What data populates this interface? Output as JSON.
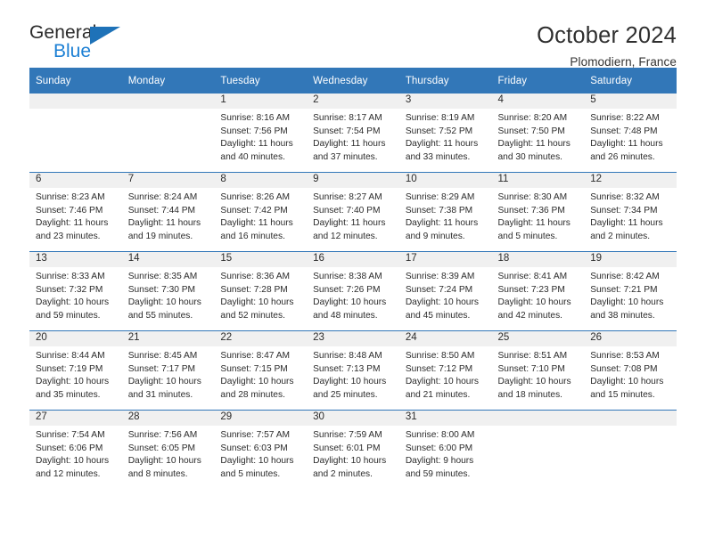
{
  "logo": {
    "text_top": "General",
    "text_bottom": "Blue",
    "triangle_color": "#1e72b8",
    "blue_color": "#1b7fd4"
  },
  "header": {
    "title": "October 2024",
    "subtitle": "Plomodiern, France"
  },
  "theme": {
    "header_blue": "#3277b8",
    "daynum_band": "#f0f0f0",
    "text": "#2b2b2b"
  },
  "weekdays": [
    "Sunday",
    "Monday",
    "Tuesday",
    "Wednesday",
    "Thursday",
    "Friday",
    "Saturday"
  ],
  "labels": {
    "sunrise_prefix": "Sunrise:",
    "sunset_prefix": "Sunset:",
    "daylight_prefix": "Daylight:"
  },
  "weeks": [
    [
      {
        "day": "",
        "sunrise": "",
        "sunset": "",
        "daylight": ""
      },
      {
        "day": "",
        "sunrise": "",
        "sunset": "",
        "daylight": ""
      },
      {
        "day": "1",
        "sunrise": "Sunrise: 8:16 AM",
        "sunset": "Sunset: 7:56 PM",
        "daylight": "Daylight: 11 hours and 40 minutes."
      },
      {
        "day": "2",
        "sunrise": "Sunrise: 8:17 AM",
        "sunset": "Sunset: 7:54 PM",
        "daylight": "Daylight: 11 hours and 37 minutes."
      },
      {
        "day": "3",
        "sunrise": "Sunrise: 8:19 AM",
        "sunset": "Sunset: 7:52 PM",
        "daylight": "Daylight: 11 hours and 33 minutes."
      },
      {
        "day": "4",
        "sunrise": "Sunrise: 8:20 AM",
        "sunset": "Sunset: 7:50 PM",
        "daylight": "Daylight: 11 hours and 30 minutes."
      },
      {
        "day": "5",
        "sunrise": "Sunrise: 8:22 AM",
        "sunset": "Sunset: 7:48 PM",
        "daylight": "Daylight: 11 hours and 26 minutes."
      }
    ],
    [
      {
        "day": "6",
        "sunrise": "Sunrise: 8:23 AM",
        "sunset": "Sunset: 7:46 PM",
        "daylight": "Daylight: 11 hours and 23 minutes."
      },
      {
        "day": "7",
        "sunrise": "Sunrise: 8:24 AM",
        "sunset": "Sunset: 7:44 PM",
        "daylight": "Daylight: 11 hours and 19 minutes."
      },
      {
        "day": "8",
        "sunrise": "Sunrise: 8:26 AM",
        "sunset": "Sunset: 7:42 PM",
        "daylight": "Daylight: 11 hours and 16 minutes."
      },
      {
        "day": "9",
        "sunrise": "Sunrise: 8:27 AM",
        "sunset": "Sunset: 7:40 PM",
        "daylight": "Daylight: 11 hours and 12 minutes."
      },
      {
        "day": "10",
        "sunrise": "Sunrise: 8:29 AM",
        "sunset": "Sunset: 7:38 PM",
        "daylight": "Daylight: 11 hours and 9 minutes."
      },
      {
        "day": "11",
        "sunrise": "Sunrise: 8:30 AM",
        "sunset": "Sunset: 7:36 PM",
        "daylight": "Daylight: 11 hours and 5 minutes."
      },
      {
        "day": "12",
        "sunrise": "Sunrise: 8:32 AM",
        "sunset": "Sunset: 7:34 PM",
        "daylight": "Daylight: 11 hours and 2 minutes."
      }
    ],
    [
      {
        "day": "13",
        "sunrise": "Sunrise: 8:33 AM",
        "sunset": "Sunset: 7:32 PM",
        "daylight": "Daylight: 10 hours and 59 minutes."
      },
      {
        "day": "14",
        "sunrise": "Sunrise: 8:35 AM",
        "sunset": "Sunset: 7:30 PM",
        "daylight": "Daylight: 10 hours and 55 minutes."
      },
      {
        "day": "15",
        "sunrise": "Sunrise: 8:36 AM",
        "sunset": "Sunset: 7:28 PM",
        "daylight": "Daylight: 10 hours and 52 minutes."
      },
      {
        "day": "16",
        "sunrise": "Sunrise: 8:38 AM",
        "sunset": "Sunset: 7:26 PM",
        "daylight": "Daylight: 10 hours and 48 minutes."
      },
      {
        "day": "17",
        "sunrise": "Sunrise: 8:39 AM",
        "sunset": "Sunset: 7:24 PM",
        "daylight": "Daylight: 10 hours and 45 minutes."
      },
      {
        "day": "18",
        "sunrise": "Sunrise: 8:41 AM",
        "sunset": "Sunset: 7:23 PM",
        "daylight": "Daylight: 10 hours and 42 minutes."
      },
      {
        "day": "19",
        "sunrise": "Sunrise: 8:42 AM",
        "sunset": "Sunset: 7:21 PM",
        "daylight": "Daylight: 10 hours and 38 minutes."
      }
    ],
    [
      {
        "day": "20",
        "sunrise": "Sunrise: 8:44 AM",
        "sunset": "Sunset: 7:19 PM",
        "daylight": "Daylight: 10 hours and 35 minutes."
      },
      {
        "day": "21",
        "sunrise": "Sunrise: 8:45 AM",
        "sunset": "Sunset: 7:17 PM",
        "daylight": "Daylight: 10 hours and 31 minutes."
      },
      {
        "day": "22",
        "sunrise": "Sunrise: 8:47 AM",
        "sunset": "Sunset: 7:15 PM",
        "daylight": "Daylight: 10 hours and 28 minutes."
      },
      {
        "day": "23",
        "sunrise": "Sunrise: 8:48 AM",
        "sunset": "Sunset: 7:13 PM",
        "daylight": "Daylight: 10 hours and 25 minutes."
      },
      {
        "day": "24",
        "sunrise": "Sunrise: 8:50 AM",
        "sunset": "Sunset: 7:12 PM",
        "daylight": "Daylight: 10 hours and 21 minutes."
      },
      {
        "day": "25",
        "sunrise": "Sunrise: 8:51 AM",
        "sunset": "Sunset: 7:10 PM",
        "daylight": "Daylight: 10 hours and 18 minutes."
      },
      {
        "day": "26",
        "sunrise": "Sunrise: 8:53 AM",
        "sunset": "Sunset: 7:08 PM",
        "daylight": "Daylight: 10 hours and 15 minutes."
      }
    ],
    [
      {
        "day": "27",
        "sunrise": "Sunrise: 7:54 AM",
        "sunset": "Sunset: 6:06 PM",
        "daylight": "Daylight: 10 hours and 12 minutes."
      },
      {
        "day": "28",
        "sunrise": "Sunrise: 7:56 AM",
        "sunset": "Sunset: 6:05 PM",
        "daylight": "Daylight: 10 hours and 8 minutes."
      },
      {
        "day": "29",
        "sunrise": "Sunrise: 7:57 AM",
        "sunset": "Sunset: 6:03 PM",
        "daylight": "Daylight: 10 hours and 5 minutes."
      },
      {
        "day": "30",
        "sunrise": "Sunrise: 7:59 AM",
        "sunset": "Sunset: 6:01 PM",
        "daylight": "Daylight: 10 hours and 2 minutes."
      },
      {
        "day": "31",
        "sunrise": "Sunrise: 8:00 AM",
        "sunset": "Sunset: 6:00 PM",
        "daylight": "Daylight: 9 hours and 59 minutes."
      },
      {
        "day": "",
        "sunrise": "",
        "sunset": "",
        "daylight": ""
      },
      {
        "day": "",
        "sunrise": "",
        "sunset": "",
        "daylight": ""
      }
    ]
  ]
}
